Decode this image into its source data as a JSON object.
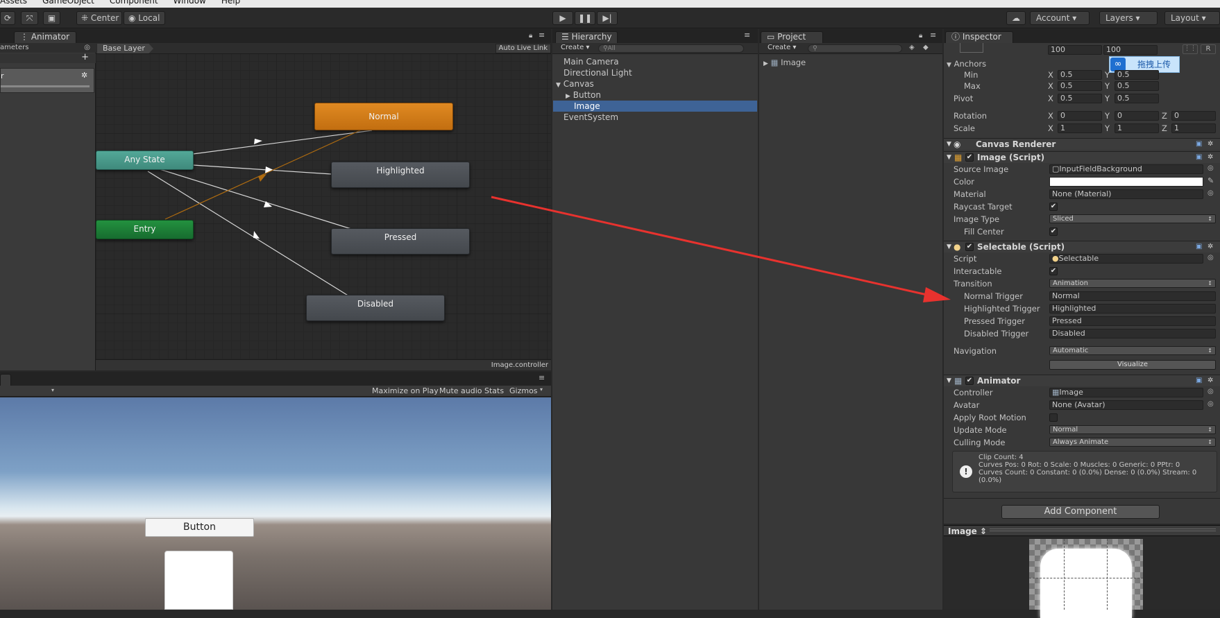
{
  "menu": [
    "Assets",
    "GameObject",
    "Component",
    "Window",
    "Help"
  ],
  "toolbar": {
    "center": "Center",
    "local": "Local",
    "account": "Account",
    "layers": "Layers",
    "layout": "Layout"
  },
  "animator": {
    "tab": "Animator",
    "params_tab": "ameters",
    "layer_item": "r",
    "base_layer": "Base Layer",
    "auto_live": "Auto Live Link",
    "footer": "Image.controller",
    "states": {
      "normal": "Normal",
      "any_state": "Any State",
      "highlighted": "Highlighted",
      "pressed": "Pressed",
      "entry": "Entry",
      "disabled": "Disabled"
    },
    "colors": {
      "normal": "#d17d1b",
      "any_state": "#4a9b8c",
      "entry": "#1d7d3a",
      "gray": "#4b4f55",
      "graph_bg": "#2a2a2a"
    }
  },
  "game": {
    "maximize": "Maximize on Play",
    "mute": "Mute audio",
    "stats": "Stats",
    "gizmos": "Gizmos",
    "button": "Button"
  },
  "hierarchy": {
    "tab": "Hierarchy",
    "create": "Create",
    "search": "All",
    "items": [
      "Main Camera",
      "Directional Light",
      "Canvas",
      "Button",
      "Image",
      "EventSystem"
    ],
    "selected": "Image"
  },
  "project": {
    "tab": "Project",
    "create": "Create",
    "item": "Image"
  },
  "inspector": {
    "tab": "Inspector",
    "width": "100",
    "height": "100",
    "upload": "拖拽上传",
    "anchors": "Anchors",
    "min": "Min",
    "max": "Max",
    "pivot": "Pivot",
    "rotation": "Rotation",
    "scale": "Scale",
    "ax": "0.5",
    "ay": "0.5",
    "rx": "0",
    "ry": "0",
    "rz": "0",
    "sx": "1",
    "sy": "1",
    "sz": "1",
    "canvas_renderer": "Canvas Renderer",
    "image_script": "Image (Script)",
    "source_image": "Source Image",
    "source_val": "InputFieldBackground",
    "color": "Color",
    "material": "Material",
    "material_val": "None (Material)",
    "raycast": "Raycast Target",
    "image_type": "Image Type",
    "image_type_val": "Sliced",
    "fill_center": "Fill Center",
    "selectable": "Selectable (Script)",
    "script": "Script",
    "script_val": "Selectable",
    "interactable": "Interactable",
    "transition": "Transition",
    "transition_val": "Animation",
    "normal_trigger": "Normal Trigger",
    "normal_val": "Normal",
    "highlighted_trigger": "Highlighted Trigger",
    "highlighted_val": "Highlighted",
    "pressed_trigger": "Pressed Trigger",
    "pressed_val": "Pressed",
    "disabled_trigger": "Disabled Trigger",
    "disabled_val": "Disabled",
    "navigation": "Navigation",
    "navigation_val": "Automatic",
    "visualize": "Visualize",
    "animator": "Animator",
    "controller": "Controller",
    "controller_val": "Image",
    "avatar": "Avatar",
    "avatar_val": "None (Avatar)",
    "apply_root": "Apply Root Motion",
    "update_mode": "Update Mode",
    "update_val": "Normal",
    "culling_mode": "Culling Mode",
    "culling_val": "Always Animate",
    "info1": "Clip Count: 4",
    "info2": "Curves Pos: 0 Rot: 0 Scale: 0 Muscles: 0 Generic: 0 PPtr: 0",
    "info3": "Curves Count: 0 Constant: 0 (0.0%) Dense: 0 (0.0%) Stream: 0",
    "info4": "(0.0%)",
    "add_component": "Add Component",
    "preview_title": "Image"
  }
}
